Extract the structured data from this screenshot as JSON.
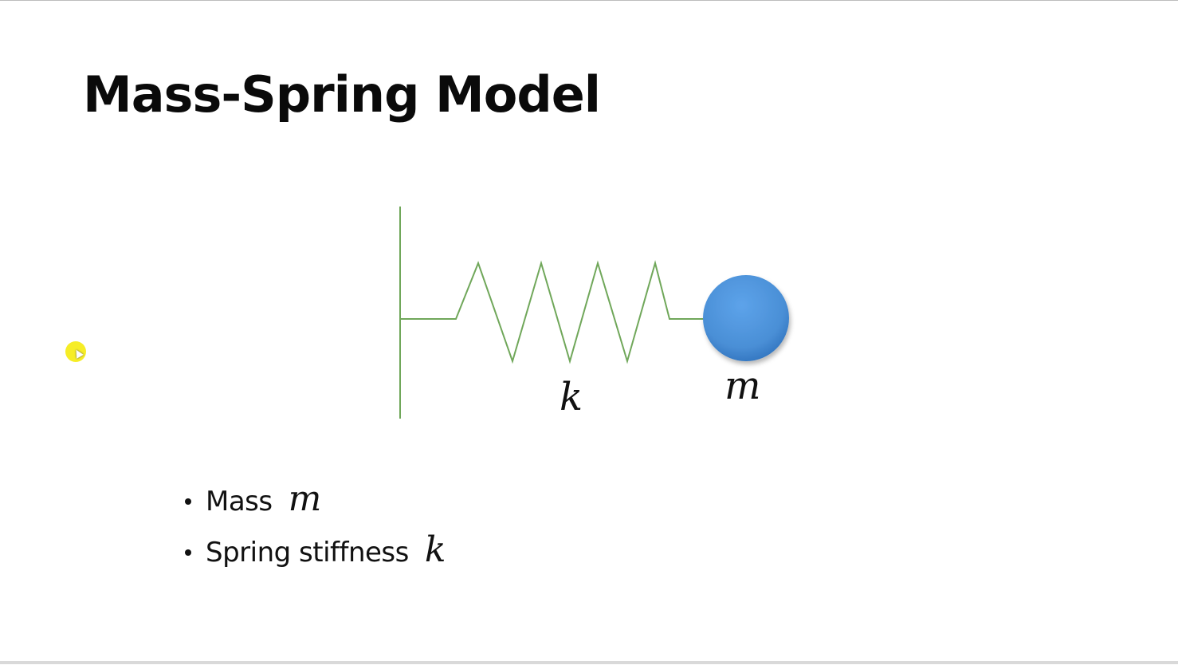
{
  "slide": {
    "title": "Mass-Spring Model"
  },
  "diagram": {
    "spring_label": "k",
    "mass_label": "m",
    "spring_color": "#70a75a",
    "wall_color": "#70a75a",
    "mass_color": "#4a8fd6"
  },
  "bullets": [
    {
      "text": "Mass",
      "var": "m"
    },
    {
      "text": "Spring stiffness",
      "var": "k"
    }
  ],
  "cursor": {
    "highlight_color": "#f6ec1a",
    "icon": "cursor-arrow-icon"
  }
}
